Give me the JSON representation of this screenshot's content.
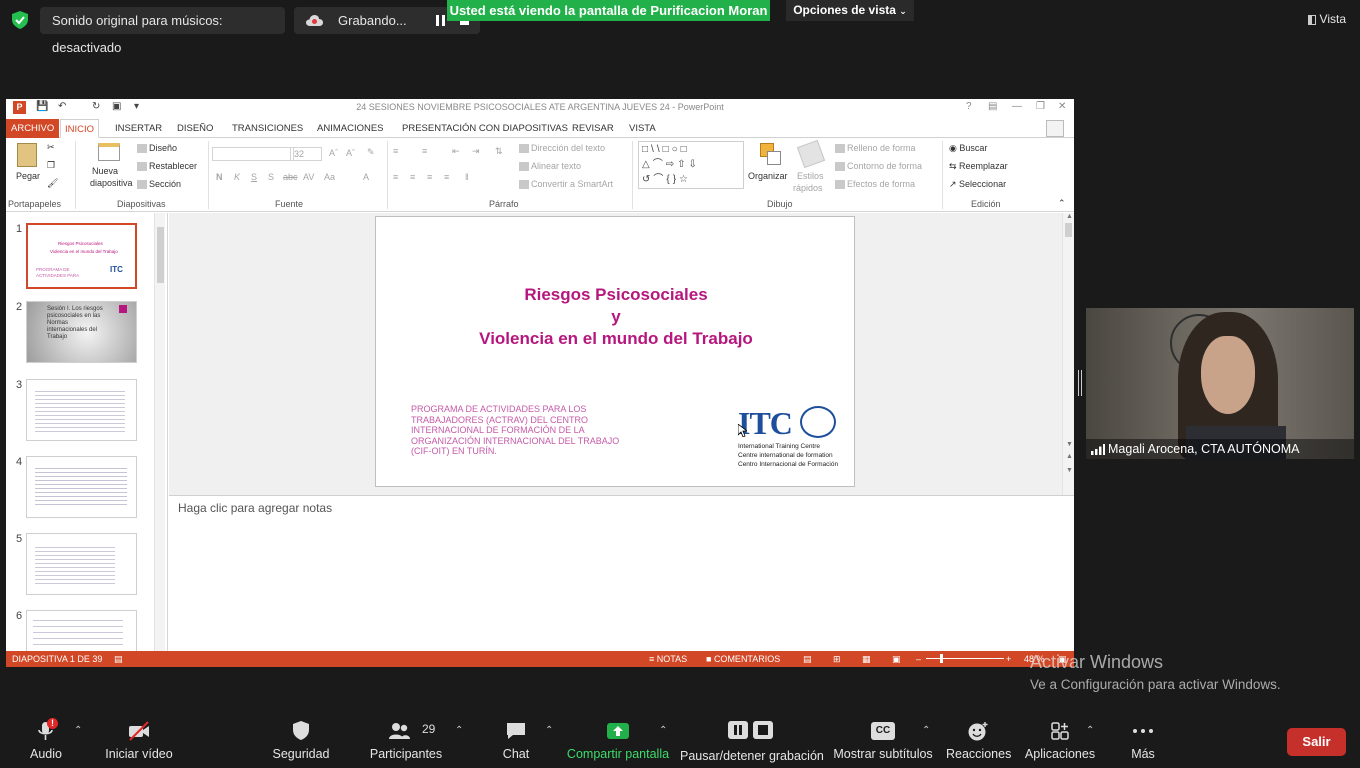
{
  "zoom_top": {
    "audio_pill": "Sonido original para músicos: desactivado",
    "recording_pill": "Grabando...",
    "share_banner": "Usted está viendo la pantalla de Purificacion Moran",
    "view_options": "Opciones de vista",
    "view_label": "Vista"
  },
  "ppt": {
    "window_title": "24 SESIONES NOVIEMBRE PSICOSOCIALES ATE ARGENTINA JUEVES 24 - PowerPoint",
    "logo": "P",
    "tabs": [
      "ARCHIVO",
      "INICIO",
      "INSERTAR",
      "DISEÑO",
      "TRANSICIONES",
      "ANIMACIONES",
      "PRESENTACIÓN CON DIAPOSITIVAS",
      "REVISAR",
      "VISTA"
    ],
    "ribbon": {
      "pegar": "Pegar",
      "nueva_diapositiva_1": "Nueva",
      "nueva_diapositiva_2": "diapositiva",
      "diseno": "Diseño",
      "restablecer": "Restablecer",
      "seccion": "Sección",
      "font_size": "32",
      "direccion_texto": "Dirección del texto",
      "alinear_texto": "Alinear texto",
      "convertir_smartart": "Convertir a SmartArt",
      "organizar": "Organizar",
      "estilos_1": "Estilos",
      "estilos_2": "rápidos",
      "relleno": "Relleno de forma",
      "contorno": "Contorno de forma",
      "efectos": "Efectos de forma",
      "buscar": "Buscar",
      "reemplazar": "Reemplazar",
      "seleccionar": "Seleccionar",
      "groups": [
        "Portapapeles",
        "Diapositivas",
        "Fuente",
        "Párrafo",
        "Dibujo",
        "Edición"
      ]
    },
    "thumb_numbers": [
      "1",
      "2",
      "3",
      "4",
      "5",
      "6"
    ],
    "thumb2_text": "Sesión I. Los riesgos psicosociales en las Normas internacionales del Trabajo",
    "slide": {
      "title_1": "Riesgos Psicosociales",
      "title_2": "y",
      "title_3": "Violencia en el mundo del Trabajo",
      "subtitle": "PROGRAMA DE ACTIVIDADES PARA LOS TRABAJADORES (ACTRAV) DEL CENTRO INTERNACIONAL DE FORMACIÓN DE LA ORGANIZACIÓN INTERNACIONAL DEL TRABAJO (CIF-OIT) EN TURÍN.",
      "logo_word": "ITC",
      "logo_line_1": "International Training Centre",
      "logo_line_2": "Centre international de formation",
      "logo_line_3": "Centro Internacional de Formación"
    },
    "notes_placeholder": "Haga clic para agregar notas",
    "status": {
      "slide_counter": "DIAPOSITIVA 1 DE 39",
      "notas": "NOTAS",
      "comentarios": "COMENTARIOS",
      "zoom": "48 %"
    }
  },
  "video": {
    "participant_name": "Magali Arocena, CTA AUTÓNOMA"
  },
  "windows_activation": {
    "line_1": "Activar Windows",
    "line_2": "Ve a Configuración para activar Windows."
  },
  "toolbar": {
    "audio": "Audio",
    "video": "Iniciar vídeo",
    "security": "Seguridad",
    "participants": "Participantes",
    "participants_count": "29",
    "chat": "Chat",
    "share": "Compartir pantalla",
    "record": "Pausar/detener grabación",
    "captions": "Mostrar subtítulos",
    "cc": "CC",
    "reactions": "Reacciones",
    "apps": "Aplicaciones",
    "more": "Más",
    "leave": "Salir"
  },
  "colors": {
    "ppt_accent": "#d24726",
    "slide_title": "#b5177e",
    "share_green": "#22b04a",
    "leave_red": "#c6302b"
  }
}
